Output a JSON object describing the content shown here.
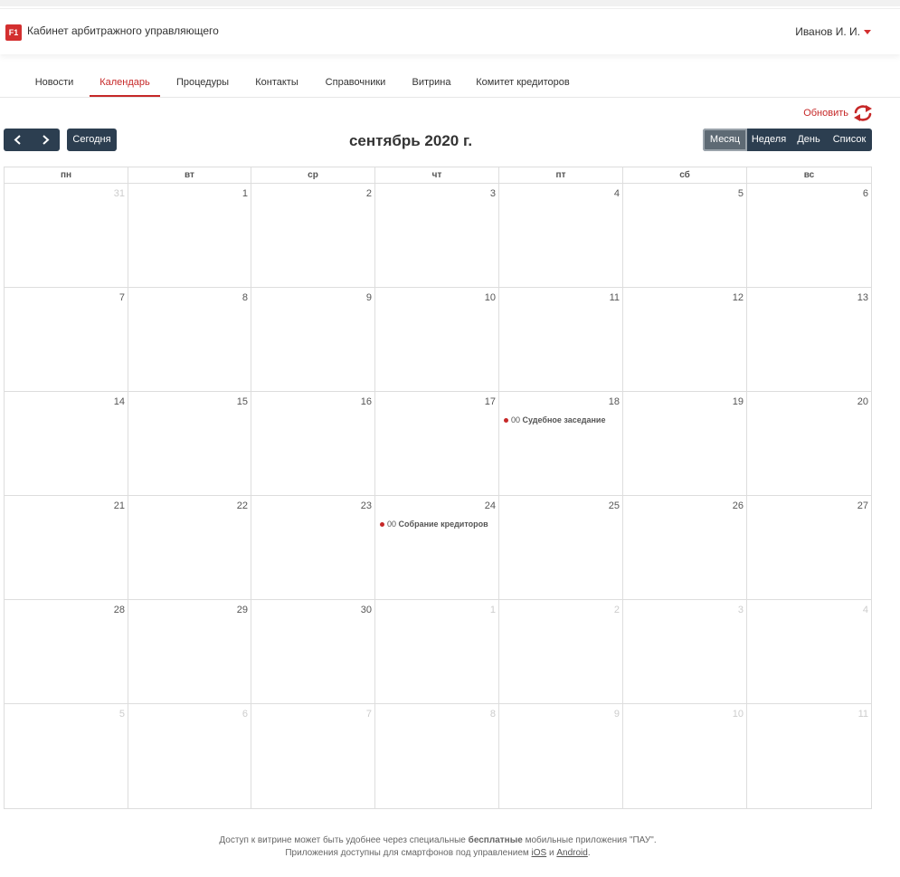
{
  "header": {
    "logo_text": "F1",
    "app_title": "Кабинет арбитражного управляющего",
    "user_name": "Иванов И. И."
  },
  "nav": {
    "items": [
      "Новости",
      "Календарь",
      "Процедуры",
      "Контакты",
      "Справочники",
      "Витрина",
      "Комитет кредиторов"
    ],
    "active": "Календарь"
  },
  "toolbar": {
    "refresh_label": "Обновить",
    "prev_icon": "chevron-left-icon",
    "next_icon": "chevron-right-icon",
    "today_label": "Сегодня",
    "title": "сентябрь 2020 г.",
    "views": [
      "Месяц",
      "Неделя",
      "День",
      "Список"
    ],
    "active_view": "Месяц"
  },
  "calendar": {
    "weekdays": [
      "пн",
      "вт",
      "ср",
      "чт",
      "пт",
      "сб",
      "вс"
    ],
    "weeks": [
      [
        {
          "d": "31",
          "other": true
        },
        {
          "d": "1"
        },
        {
          "d": "2"
        },
        {
          "d": "3"
        },
        {
          "d": "4"
        },
        {
          "d": "5"
        },
        {
          "d": "6"
        }
      ],
      [
        {
          "d": "7"
        },
        {
          "d": "8"
        },
        {
          "d": "9"
        },
        {
          "d": "10"
        },
        {
          "d": "11"
        },
        {
          "d": "12"
        },
        {
          "d": "13"
        }
      ],
      [
        {
          "d": "14"
        },
        {
          "d": "15"
        },
        {
          "d": "16"
        },
        {
          "d": "17"
        },
        {
          "d": "18",
          "event_time": "00",
          "event_title": "Судебное заседание"
        },
        {
          "d": "19"
        },
        {
          "d": "20"
        }
      ],
      [
        {
          "d": "21"
        },
        {
          "d": "22"
        },
        {
          "d": "23"
        },
        {
          "d": "24",
          "event_time": "00",
          "event_title": "Собрание кредиторов"
        },
        {
          "d": "25"
        },
        {
          "d": "26"
        },
        {
          "d": "27"
        }
      ],
      [
        {
          "d": "28"
        },
        {
          "d": "29"
        },
        {
          "d": "30"
        },
        {
          "d": "1",
          "other": true
        },
        {
          "d": "2",
          "other": true
        },
        {
          "d": "3",
          "other": true
        },
        {
          "d": "4",
          "other": true
        }
      ],
      [
        {
          "d": "5",
          "other": true
        },
        {
          "d": "6",
          "other": true
        },
        {
          "d": "7",
          "other": true
        },
        {
          "d": "8",
          "other": true
        },
        {
          "d": "9",
          "other": true
        },
        {
          "d": "10",
          "other": true
        },
        {
          "d": "11",
          "other": true
        }
      ]
    ],
    "event_color": "#c62828"
  },
  "footer": {
    "line1_pre": "Доступ к витрине может быть удобнее через специальные ",
    "line1_bold": "бесплатные",
    "line1_post": " мобильные приложения \"ПАУ\".",
    "line2_pre": "Приложения доступны для смартфонов под управлением ",
    "ios": "iOS",
    "and": " и ",
    "android": "Android",
    "line2_post": "."
  },
  "colors": {
    "accent": "#c62828",
    "dark_button": "#2c3e50"
  }
}
